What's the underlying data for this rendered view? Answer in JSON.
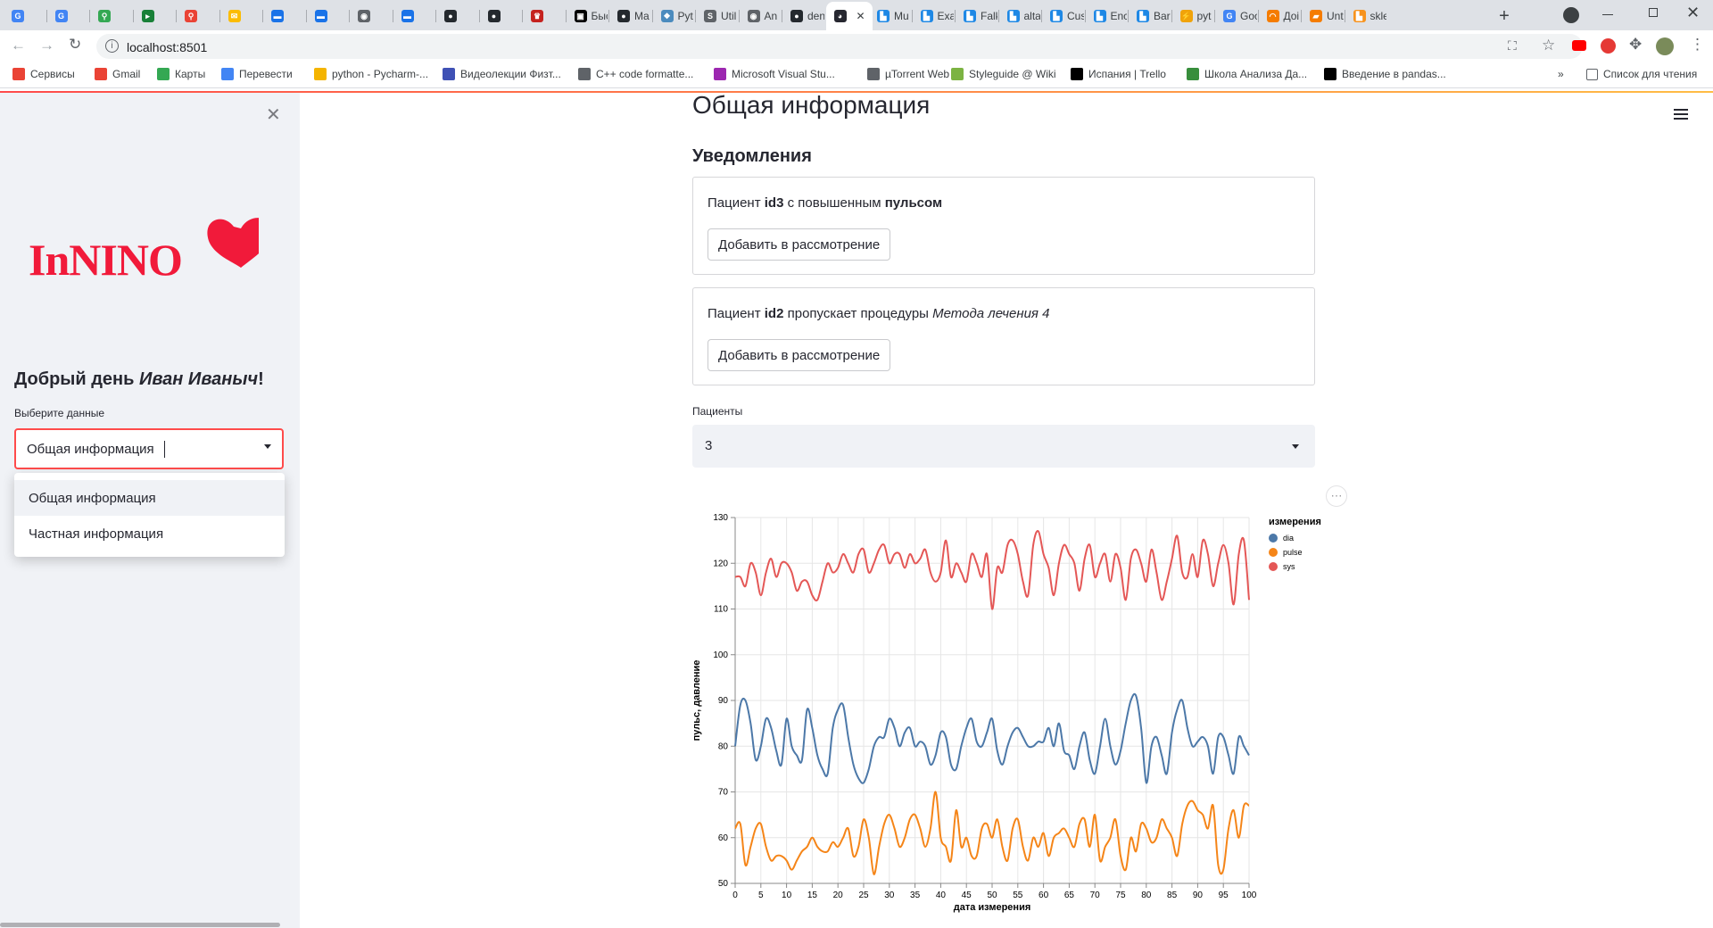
{
  "browser": {
    "tabs": [
      {
        "label": "",
        "color": "#4285f4",
        "glyph": "G"
      },
      {
        "label": "",
        "color": "#4285f4",
        "glyph": "G"
      },
      {
        "label": "",
        "color": "#34a853",
        "glyph": "⚲"
      },
      {
        "label": "",
        "color": "#188038",
        "glyph": "▸"
      },
      {
        "label": "",
        "color": "#ea4335",
        "glyph": "⚲"
      },
      {
        "label": "",
        "color": "#fbbc04",
        "glyph": "✉"
      },
      {
        "label": "",
        "color": "#1a73e8",
        "glyph": "▬"
      },
      {
        "label": "",
        "color": "#1a73e8",
        "glyph": "▬"
      },
      {
        "label": "",
        "color": "#5f6368",
        "glyph": "◉"
      },
      {
        "label": "",
        "color": "#1a73e8",
        "glyph": "▬"
      },
      {
        "label": "",
        "color": "#24292e",
        "glyph": "●"
      },
      {
        "label": "",
        "color": "#24292e",
        "glyph": "●"
      },
      {
        "label": "",
        "color": "#c5221f",
        "glyph": "♛"
      },
      {
        "label": "Быс",
        "color": "#000000",
        "glyph": "▣"
      },
      {
        "label": "Ma",
        "color": "#24292e",
        "glyph": "●"
      },
      {
        "label": "Pyt",
        "color": "#4b8bbe",
        "glyph": "❖"
      },
      {
        "label": "Util",
        "color": "#5f6368",
        "glyph": "S"
      },
      {
        "label": "An",
        "color": "#5f6368",
        "glyph": "◉"
      },
      {
        "label": "den",
        "color": "#24292e",
        "glyph": "●"
      },
      {
        "label": "",
        "color": "#262730",
        "glyph": "◕",
        "active": true
      },
      {
        "label": "Mu",
        "color": "#1e88e5",
        "glyph": "▙"
      },
      {
        "label": "Exa",
        "color": "#1e88e5",
        "glyph": "▙"
      },
      {
        "label": "Falk",
        "color": "#1e88e5",
        "glyph": "▙"
      },
      {
        "label": "alta",
        "color": "#1e88e5",
        "glyph": "▙"
      },
      {
        "label": "Cus",
        "color": "#1e88e5",
        "glyph": "▙"
      },
      {
        "label": "Enc",
        "color": "#1e88e5",
        "glyph": "▙"
      },
      {
        "label": "Bar",
        "color": "#1e88e5",
        "glyph": "▙"
      },
      {
        "label": "pyt",
        "color": "#f0a30a",
        "glyph": "⚡"
      },
      {
        "label": "Goo",
        "color": "#4285f4",
        "glyph": "G"
      },
      {
        "label": "Доі",
        "color": "#f57c00",
        "glyph": "◠"
      },
      {
        "label": "Unt",
        "color": "#f57c00",
        "glyph": "▰"
      },
      {
        "label": "skle",
        "color": "#f7931e",
        "glyph": "▙"
      }
    ],
    "address": "localhost:8501",
    "bookmarks": [
      {
        "label": "Сервисы",
        "color": "#ea4335"
      },
      {
        "label": "Gmail",
        "color": "#ea4335"
      },
      {
        "label": "Карты",
        "color": "#34a853"
      },
      {
        "label": "Перевести",
        "color": "#4285f4"
      },
      {
        "label": "python - Pycharm-...",
        "color": "#f4b400"
      },
      {
        "label": "Видеолекции Физт...",
        "color": "#3f51b5"
      },
      {
        "label": "C++ code formatte...",
        "color": "#5f6368"
      },
      {
        "label": "Microsoft Visual Stu...",
        "color": "#9c27b0"
      },
      {
        "label": "µTorrent Web",
        "color": "#5f6368"
      },
      {
        "label": "Styleguide @ Wiki",
        "color": "#7cb342"
      },
      {
        "label": "Испания | Trello",
        "color": "#000000"
      },
      {
        "label": "Школа Анализа Да...",
        "color": "#388e3c"
      },
      {
        "label": "Введение в pandas...",
        "color": "#000000"
      }
    ],
    "more_bookmarks": "»",
    "reading_list": "Список для чтения"
  },
  "sidebar": {
    "logo_text": "InNINO",
    "greeting_prefix": "Добрый день ",
    "greeting_name": "Иван Иваныч",
    "greeting_suffix": "!",
    "select_label": "Выберите данные",
    "select_value": "Общая информация",
    "options": [
      "Общая информация",
      "Частная информация"
    ]
  },
  "main": {
    "title": "Общая информация",
    "notifications_header": "Уведомления",
    "notifications": [
      {
        "prefix": "Пациент ",
        "bold1": "id3",
        "middle": " с повышенным ",
        "bold2": "пульсом",
        "button": "Добавить в рассмотрение"
      },
      {
        "prefix": "Пациент ",
        "bold1": "id2",
        "middle": " пропускает процедуры ",
        "italic": "Метода лечения 4",
        "button": "Добавить в рассмотрение"
      }
    ],
    "patients_label": "Пациенты",
    "patients_value": "3",
    "chart_menu": "⋯"
  },
  "colors": {
    "primary": "#ff4b4b",
    "dia": "#4c78a8",
    "pulse": "#f58518",
    "sys": "#e45756"
  },
  "chart_data": {
    "type": "line",
    "xlabel": "дата измерения",
    "ylabel": "пульс, давление",
    "xlim": [
      0,
      100
    ],
    "ylim": [
      50,
      130
    ],
    "x_ticks": [
      0,
      5,
      10,
      15,
      20,
      25,
      30,
      35,
      40,
      45,
      50,
      55,
      60,
      65,
      70,
      75,
      80,
      85,
      90,
      95,
      100
    ],
    "y_ticks": [
      50,
      60,
      70,
      80,
      90,
      100,
      110,
      120,
      130
    ],
    "grid": true,
    "legend_title": "измерения",
    "legend_position": "right",
    "x": [
      0,
      1,
      2,
      3,
      4,
      5,
      6,
      7,
      8,
      9,
      10,
      11,
      12,
      13,
      14,
      15,
      16,
      17,
      18,
      19,
      20,
      21,
      22,
      23,
      24,
      25,
      26,
      27,
      28,
      29,
      30,
      31,
      32,
      33,
      34,
      35,
      36,
      37,
      38,
      39,
      40,
      41,
      42,
      43,
      44,
      45,
      46,
      47,
      48,
      49,
      50,
      51,
      52,
      53,
      54,
      55,
      56,
      57,
      58,
      59,
      60,
      61,
      62,
      63,
      64,
      65,
      66,
      67,
      68,
      69,
      70,
      71,
      72,
      73,
      74,
      75,
      76,
      77,
      78,
      79,
      80,
      81,
      82,
      83,
      84,
      85,
      86,
      87,
      88,
      89,
      90,
      91,
      92,
      93,
      94,
      95,
      96,
      97,
      98,
      99,
      100
    ],
    "series": [
      {
        "name": "dia",
        "values": [
          80,
          89,
          90,
          85,
          77,
          80,
          86,
          84,
          79,
          76,
          86,
          80,
          78,
          77,
          88,
          84,
          78,
          75,
          74,
          84,
          88,
          89,
          82,
          76,
          73,
          72,
          75,
          80,
          82,
          82,
          86,
          84,
          80,
          83,
          84,
          80,
          81,
          80,
          76,
          78,
          83,
          82,
          76,
          75,
          80,
          84,
          86,
          81,
          80,
          83,
          86,
          79,
          76,
          80,
          83,
          84,
          82,
          80,
          80,
          81,
          81,
          84,
          80,
          85,
          79,
          78,
          75,
          80,
          83,
          77,
          74,
          80,
          86,
          80,
          76,
          79,
          85,
          90,
          91,
          84,
          72,
          80,
          82,
          78,
          74,
          83,
          88,
          90,
          84,
          80,
          81,
          82,
          80,
          74,
          82,
          82,
          78,
          74,
          82,
          80,
          78
        ]
      },
      {
        "name": "pulse",
        "values": [
          62,
          63,
          54,
          58,
          62,
          63,
          58,
          55,
          56,
          56,
          55,
          53,
          55,
          57,
          58,
          60,
          58,
          57,
          57,
          59,
          58,
          60,
          62,
          56,
          58,
          64,
          60,
          52,
          58,
          63,
          65,
          62,
          58,
          60,
          64,
          65,
          62,
          58,
          62,
          70,
          60,
          58,
          55,
          66,
          58,
          60,
          56,
          56,
          62,
          63,
          60,
          64,
          58,
          55,
          62,
          64,
          58,
          55,
          60,
          58,
          61,
          56,
          60,
          61,
          62,
          60,
          58,
          63,
          64,
          58,
          65,
          55,
          58,
          60,
          64,
          56,
          53,
          60,
          57,
          63,
          62,
          59,
          60,
          64,
          62,
          60,
          56,
          63,
          67,
          68,
          66,
          65,
          62,
          67,
          54,
          53,
          62,
          66,
          60,
          67,
          67
        ]
      },
      {
        "name": "sys",
        "values": [
          117,
          117,
          115,
          120,
          118,
          113,
          118,
          121,
          117,
          120,
          120,
          118,
          114,
          116,
          116,
          113,
          112,
          116,
          120,
          118,
          119,
          122,
          120,
          118,
          122,
          123,
          118,
          120,
          123,
          124,
          120,
          122,
          122,
          119,
          122,
          120,
          121,
          123,
          118,
          116,
          118,
          125,
          117,
          120,
          118,
          116,
          122,
          120,
          117,
          122,
          110,
          119,
          118,
          124,
          125,
          122,
          116,
          113,
          124,
          127,
          122,
          119,
          113,
          120,
          124,
          122,
          120,
          114,
          121,
          124,
          117,
          120,
          122,
          116,
          122,
          119,
          112,
          121,
          123,
          120,
          116,
          123,
          118,
          112,
          116,
          121,
          126,
          118,
          117,
          122,
          117,
          125,
          122,
          115,
          120,
          124,
          120,
          111,
          122,
          125,
          112
        ]
      }
    ]
  }
}
